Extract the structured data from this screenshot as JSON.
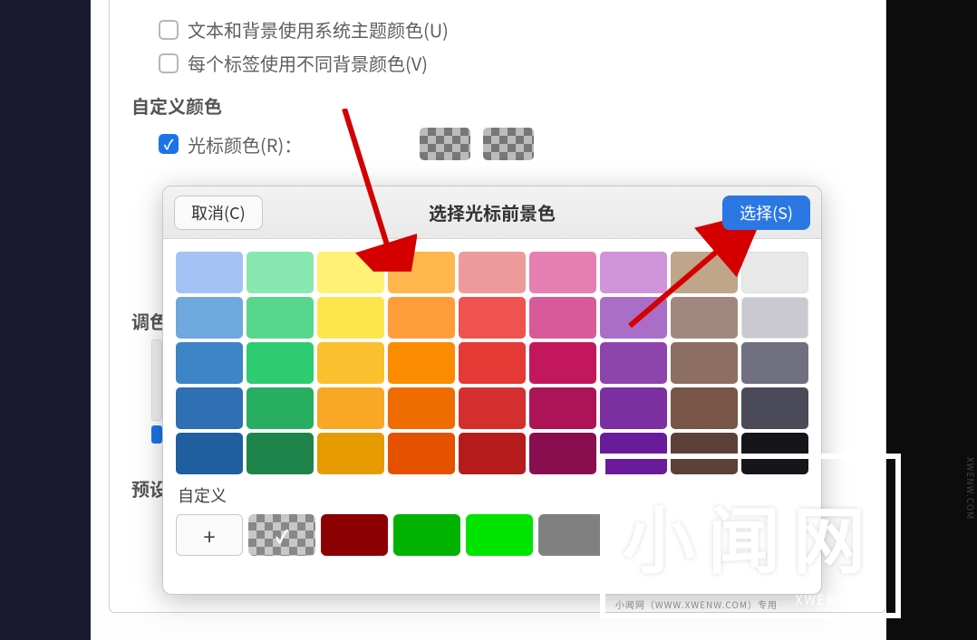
{
  "options": {
    "use_system_theme_label": "文本和背景使用系统主题颜色(U)",
    "per_tab_bg_label": "每个标签使用不同背景颜色(V)",
    "custom_colors_title": "自定义颜色",
    "cursor_color_label": "光标颜色(R)：",
    "palette_section": "调色",
    "preset_section": "预设"
  },
  "dialog": {
    "cancel_label": "取消(C)",
    "title": "选择光标前景色",
    "select_label": "选择(S)",
    "custom_label": "自定义",
    "add_label": "+",
    "palette": [
      [
        "#a4c2f4",
        "#87e8b0",
        "#fff176",
        "#ffb74d",
        "#ef9a9a",
        "#e57fb1",
        "#ce93d8",
        "#bfa58a",
        "#ffffff"
      ],
      [
        "#6fa8dc",
        "#57d68d",
        "#ffe54c",
        "#ff9d3a",
        "#ef5350",
        "#d85a9a",
        "#ab6ec6",
        "#a1887f",
        "#eeeeee"
      ],
      [
        "#3d85c6",
        "#2ecc71",
        "#fbc02d",
        "#fb8c00",
        "#e53935",
        "#c2185b",
        "#8e44ad",
        "#8d6e63",
        "#d6d6d6"
      ],
      [
        "#2f6fb3",
        "#27ae60",
        "#f9a825",
        "#ef6c00",
        "#d32f2f",
        "#ad1457",
        "#7b2fa0",
        "#795548",
        "#8e8e8e"
      ],
      [
        "#1f5fa0",
        "#1e8449",
        "#e69b00",
        "#e65100",
        "#b71c1c",
        "#880e4f",
        "#6a1b9a",
        "#5d4037",
        "#424242"
      ]
    ],
    "gray_variants": [
      "#e8e8e8",
      "#c9c9cf",
      "#707080",
      "#4a4a58",
      "#15151a"
    ],
    "custom_swatches": [
      "#8b0000",
      "#00b300",
      "#00e400",
      "#808080"
    ]
  },
  "watermark": {
    "big": "小闻网",
    "sub": "XWENW.COM",
    "side": "XWENW.COM",
    "footer": "小闻网（WWW.XWENW.COM）专用"
  }
}
